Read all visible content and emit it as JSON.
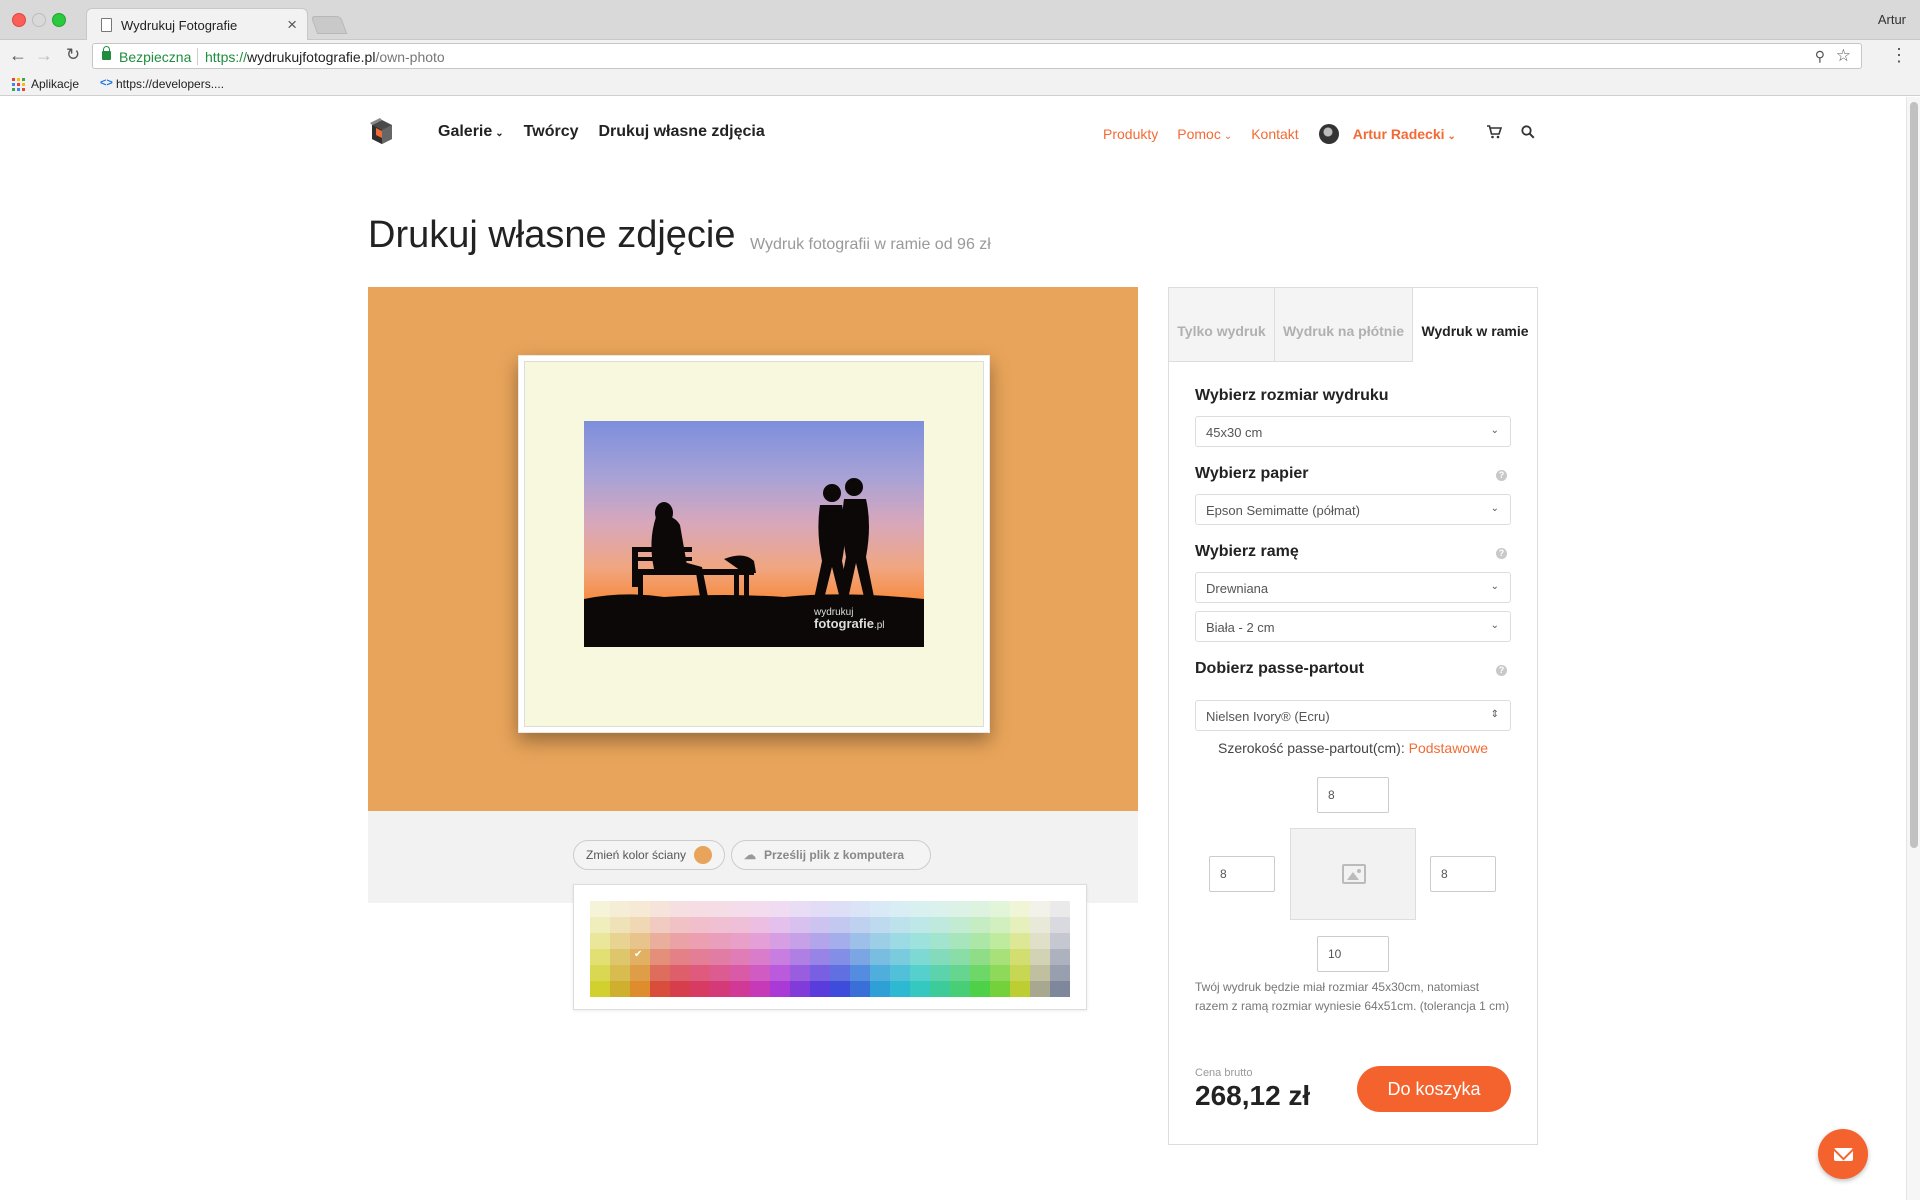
{
  "browser": {
    "tab_title": "Wydrukuj Fotografie",
    "tab_close": "×",
    "user": "Artur",
    "secure_label": "Bezpieczna",
    "url_protocol": "https://",
    "url_host": "wydrukujfotografie.pl",
    "url_path": "/own-photo",
    "bookmarks": [
      {
        "label": "Aplikacje"
      },
      {
        "label": "https://developers...."
      }
    ],
    "icons": {
      "back": "←",
      "forward": "→",
      "reload": "↻",
      "pin": "⚲",
      "star": "☆",
      "menu": "⋮"
    }
  },
  "nav": {
    "main": [
      {
        "label": "Galerie",
        "dropdown": true
      },
      {
        "label": "Twórcy"
      },
      {
        "label": "Drukuj własne zdjęcia"
      }
    ],
    "right": [
      {
        "label": "Produkty"
      },
      {
        "label": "Pomoc",
        "dropdown": true
      },
      {
        "label": "Kontakt"
      }
    ],
    "user_name": "Artur Radecki",
    "caret": "⌄",
    "cart_icon": "🛒",
    "search_icon": "⚲"
  },
  "page": {
    "title": "Drukuj własne zdjęcie",
    "subtitle": "Wydruk fotografii w ramie od 96 zł"
  },
  "preview": {
    "wall_color": "#e8a45a",
    "mat_color": "#f8f8de",
    "watermark_top": "wydrukuj",
    "watermark_bottom_bold": "fotografie",
    "watermark_bottom_light": ".pl",
    "change_wall_label": "Zmień kolor ściany",
    "upload_label": "Prześlij plik z komputera",
    "upload_icon": "☁"
  },
  "palette": {
    "rows": [
      [
        "#f6f4d8",
        "#f5edd6",
        "#f6e9d6",
        "#f6e3da",
        "#f6dfe0",
        "#f6dde3",
        "#f5dde6",
        "#f5dcea",
        "#f4dcef",
        "#efdcf3",
        "#e9dcf5",
        "#e2dcf6",
        "#dcdff6",
        "#dae4f6",
        "#d9e9f5",
        "#d9edf4",
        "#d9f0f1",
        "#daf1ec",
        "#dcf2e6",
        "#ddf3df",
        "#e3f5d8",
        "#eff5d6",
        "#f2f2ea",
        "#eaeaea"
      ],
      [
        "#f1eebe",
        "#efe2b9",
        "#f0d8b5",
        "#f1cbc1",
        "#f1c2c5",
        "#f1bfcb",
        "#f0bfd1",
        "#efbfd8",
        "#ecbfe2",
        "#e4c0ec",
        "#d9c1ef",
        "#ccc3f0",
        "#c2c8f0",
        "#bed2ef",
        "#bddaee",
        "#bde2ec",
        "#bee8e7",
        "#c0e9dd",
        "#c3ebd1",
        "#c6ecc4",
        "#d2efbf",
        "#e6f0bc",
        "#e9e9da",
        "#d8dae0"
      ],
      [
        "#eae79a",
        "#e8d393",
        "#e9c38c",
        "#eaae9d",
        "#eba2a7",
        "#eb9fb1",
        "#e99fbb",
        "#e89fc8",
        "#e39fd6",
        "#d69fe3",
        "#c6a1e8",
        "#b2a5ea",
        "#a4aeea",
        "#9dc0e8",
        "#9ccfe6",
        "#9cdae4",
        "#9ee2dd",
        "#a2e4cd",
        "#a7e5bd",
        "#ace7a7",
        "#bfeb9e",
        "#dde897",
        "#e0e0c8",
        "#c5c8d1"
      ],
      [
        "#e2df73",
        "#ddc66b",
        "#e1b063",
        "#e38f7a",
        "#e48186",
        "#e47d96",
        "#e17da4",
        "#e07db7",
        "#d97dcb",
        "#c87de0",
        "#b07fe4",
        "#9884e6",
        "#838ee6",
        "#7ba5e3",
        "#79bde1",
        "#7acbde",
        "#7ed8d4",
        "#83dbbc",
        "#8adda6",
        "#8fdd86",
        "#a8e17a",
        "#d3de70",
        "#d2d2b5",
        "#aeb2bf"
      ],
      [
        "#dad852",
        "#d8bc4f",
        "#e09d48",
        "#df6d5d",
        "#df5e6b",
        "#df5a7d",
        "#dc5b90",
        "#d95ba8",
        "#d05bc3",
        "#b95bdc",
        "#995ddf",
        "#795fe2",
        "#6170e1",
        "#548cdf",
        "#50aedc",
        "#50c1d8",
        "#56d0cc",
        "#5dd3ad",
        "#66d590",
        "#6dd767",
        "#8ed85a",
        "#c7d753",
        "#c0c0a0",
        "#98a0b0"
      ],
      [
        "#d2d02e",
        "#ceaf2e",
        "#de8c2c",
        "#d84d3c",
        "#d73e4c",
        "#d73a62",
        "#d43a78",
        "#d03a96",
        "#c63ab8",
        "#a93ad6",
        "#813bd9",
        "#5a3bdc",
        "#3e4cdb",
        "#3a6fd8",
        "#2fa0d5",
        "#2fb8d2",
        "#35c8c1",
        "#3dcb9a",
        "#47ce77",
        "#4fd049",
        "#75d13b",
        "#bcce31",
        "#a8a890",
        "#7f879c"
      ]
    ],
    "selected": {
      "row": 3,
      "col": 2
    }
  },
  "config": {
    "tabs": [
      {
        "label": "Tylko wydruk",
        "active": false
      },
      {
        "label": "Wydruk na płótnie",
        "active": false
      },
      {
        "label": "Wydruk w ramie",
        "active": true
      }
    ],
    "size_label": "Wybierz rozmiar wydruku",
    "size_value": "45x30 cm",
    "paper_label": "Wybierz papier",
    "paper_value": "Epson Semimatte (półmat)",
    "frame_label": "Wybierz ramę",
    "frame_type_value": "Drewniana",
    "frame_color_value": "Biała - 2 cm",
    "mat_label": "Dobierz passe-partout",
    "mat_value": "Nielsen Ivory® (Ecru)",
    "help_icon": "?",
    "select_chevron": "⌄",
    "mat_chevron": "⇕",
    "mat_width_label": "Szerokość passe-partout(cm): ",
    "mat_width_link": "Podstawowe",
    "mat_top": "8",
    "mat_left": "8",
    "mat_right": "8",
    "mat_bottom": "10",
    "info": "Twój wydruk będzie miał rozmiar 45x30cm, natomiast razem z ramą rozmiar wyniesie 64x51cm. (tolerancja 1 cm)",
    "price_label": "Cena brutto",
    "price_value": "268,12 zł",
    "cart_button": "Do koszyka"
  },
  "colors": {
    "accent": "#f4632d",
    "link": "#f26b36"
  }
}
